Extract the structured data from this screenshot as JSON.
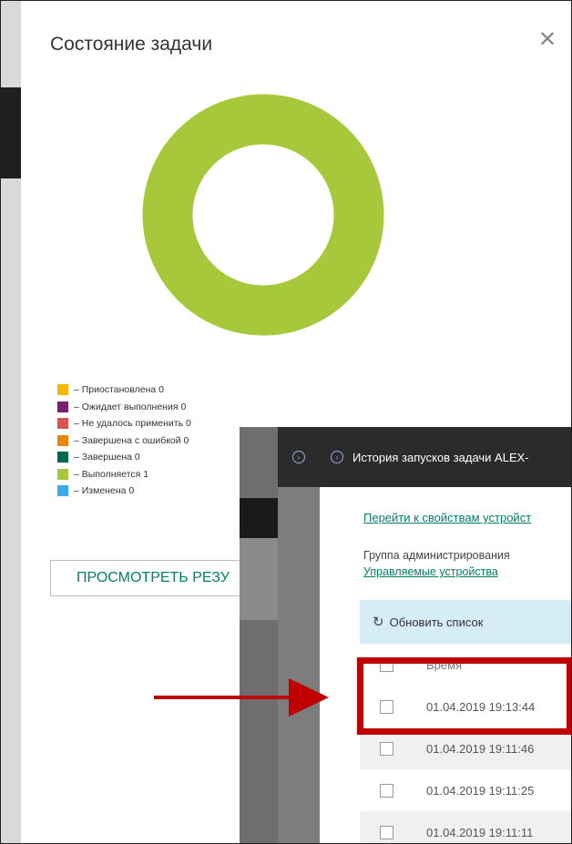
{
  "dialog": {
    "title": "Состояние задачи",
    "close_icon": "close-icon",
    "result_button_label": "ПРОСМОТРЕТЬ РЕЗУ"
  },
  "donut_chart": {
    "type": "pie",
    "values": [
      1
    ],
    "color": "#a8c83c"
  },
  "legend": [
    {
      "label": "– Приостановлена 0",
      "color": "#f5b700"
    },
    {
      "label": "– Ожидает выполнения 0",
      "color": "#7a1f6e"
    },
    {
      "label": "– Не удалось применить 0",
      "color": "#d9534f"
    },
    {
      "label": "– Завершена с ошибкой 0",
      "color": "#e8860c"
    },
    {
      "label": "– Завершена 0",
      "color": "#00694f"
    },
    {
      "label": "– Выполняется 1",
      "color": "#a8c83c"
    },
    {
      "label": "– Изменена 0",
      "color": "#3fa9e8"
    }
  ],
  "history_window": {
    "header_title": "История запусков задачи ALEX-",
    "device_properties_link": "Перейти к свойствам устройст",
    "admin_group_label": "Группа администрирования",
    "managed_devices_link": "Управляемые устройства",
    "refresh_label": "Обновить список",
    "column_time": "Время",
    "rows": [
      "01.04.2019 19:13:44",
      "01.04.2019 19:11:46",
      "01.04.2019 19:11:25",
      "01.04.2019 19:11:11"
    ]
  },
  "annotation_color": "#c00000"
}
